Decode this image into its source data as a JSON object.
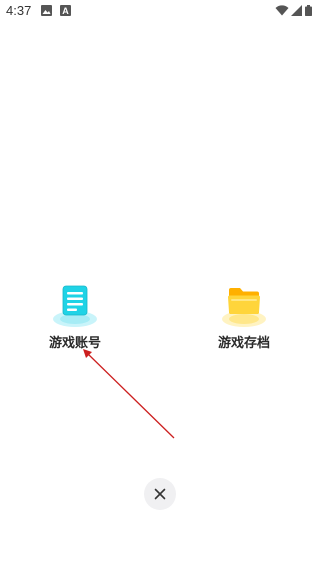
{
  "status_bar": {
    "time": "4:37",
    "icons": [
      "image-icon",
      "a-icon",
      "wifi-icon",
      "signal-icon",
      "battery-icon"
    ]
  },
  "items": [
    {
      "label": "游戏账号",
      "icon": "document-icon"
    },
    {
      "label": "游戏存档",
      "icon": "folder-icon"
    }
  ],
  "close_button": {
    "icon": "close-icon"
  },
  "colors": {
    "accent_cyan": "#1fd3e6",
    "folder_yellow": "#ffc400",
    "annotation_red": "#cc1f1f"
  }
}
